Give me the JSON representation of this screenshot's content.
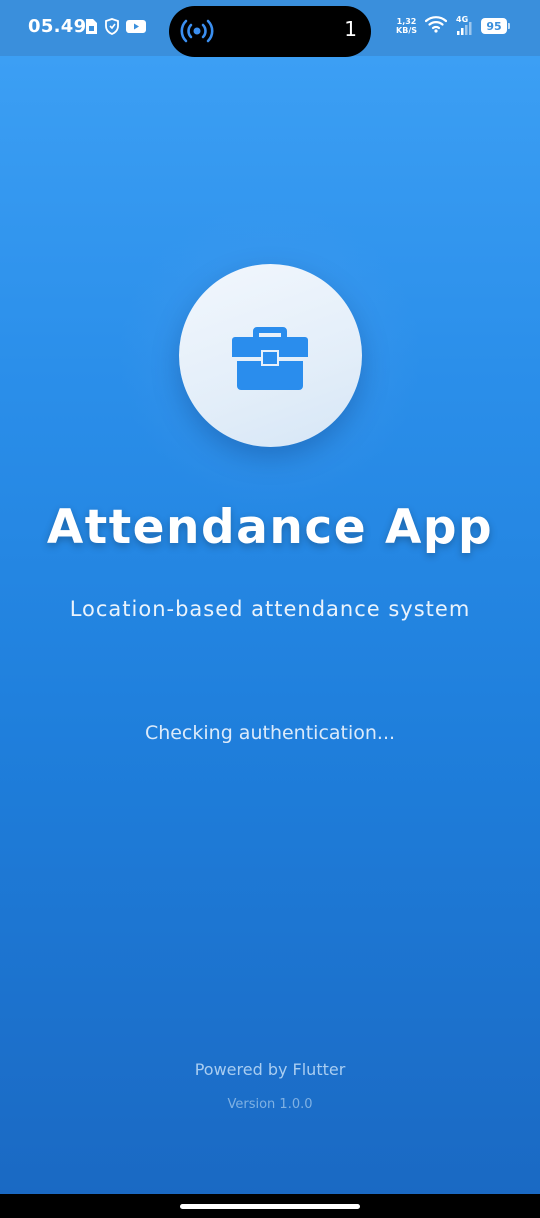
{
  "status_bar": {
    "time": "05.49",
    "left_icons": [
      "sim-card-icon",
      "hand-shield-icon",
      "youtube-icon"
    ],
    "island": {
      "icon": "broadcast-icon",
      "count": "1"
    },
    "network_speed_value": "1,32",
    "network_speed_unit": "KB/S",
    "wifi_icon": "wifi-icon",
    "signal_label": "4G",
    "battery_level": "95"
  },
  "splash": {
    "logo_icon": "briefcase-icon",
    "title": "Attendance App",
    "subtitle": "Location-based attendance system",
    "status": "Checking authentication...",
    "powered_by": "Powered by Flutter",
    "version": "Version 1.0.0"
  },
  "colors": {
    "background_top": "#3fa2f6",
    "background_bottom": "#1a68c2",
    "logo_circle": "#e8f1fb",
    "icon_accent": "#2a8ded",
    "text_primary": "#ffffff"
  }
}
